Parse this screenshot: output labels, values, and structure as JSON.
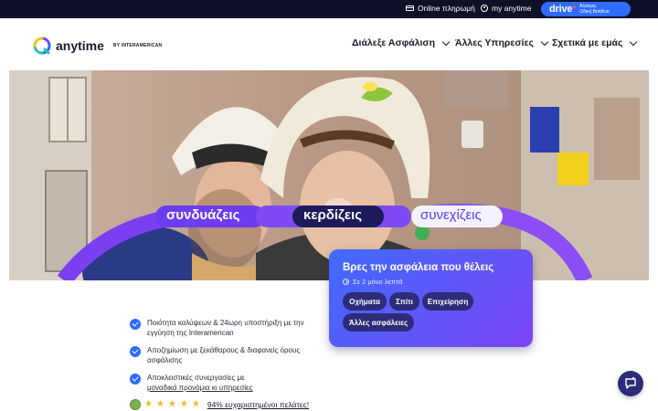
{
  "topbar": {
    "online_payment": "Online πληρωμή",
    "my_anytime": "my anytime",
    "drive": {
      "brand": "drive",
      "sub_line1": "Άλλαγες",
      "sub_line2": "Οδική Βοήθεια"
    }
  },
  "header": {
    "logo_word": "anytime",
    "logo_by": "BY INTERAMERICAN",
    "nav": [
      {
        "label": "Διάλεξε Ασφάλιση"
      },
      {
        "label": "Άλλες Υπηρεσίες"
      },
      {
        "label": "Σχετικά με εμάς"
      }
    ]
  },
  "hero": {
    "slogan": [
      "συνδυάζεις",
      "κερδίζεις",
      "συνεχίζεις"
    ]
  },
  "finder": {
    "title": "Βρες την ασφάλεια που θέλεις",
    "time": "Σε 2 μόνο λεπτά",
    "chips": [
      "Οχήματα",
      "Σπίτι",
      "Επιχείρηση",
      "Άλλες ασφάλειες"
    ]
  },
  "benefits": [
    {
      "text": "Ποιότητα καλύψεων & 24ωρη υποστήριξη με την εγγύηση της Interamerican"
    },
    {
      "text": "Αποζημίωση με ξεκάθαρους & διαφανείς όρους ασφάλισης"
    },
    {
      "text": "Αποκλειστικές συνεργασίες με",
      "link": "μοναδικά προνόμια κι υπηρεσίες"
    }
  ],
  "rating": {
    "stars": 5,
    "text": "94% ευχαριστημένοι πελάτες!"
  },
  "colors": {
    "topbar": "#0f1027",
    "accent_blue": "#2f6bff",
    "accent_purple": "#7b45f2",
    "navy": "#2d2c7a"
  },
  "icons": {
    "payment": "credit-card-icon",
    "account": "user-circle-icon",
    "clock": "clock-icon",
    "chat": "chat-icon"
  }
}
